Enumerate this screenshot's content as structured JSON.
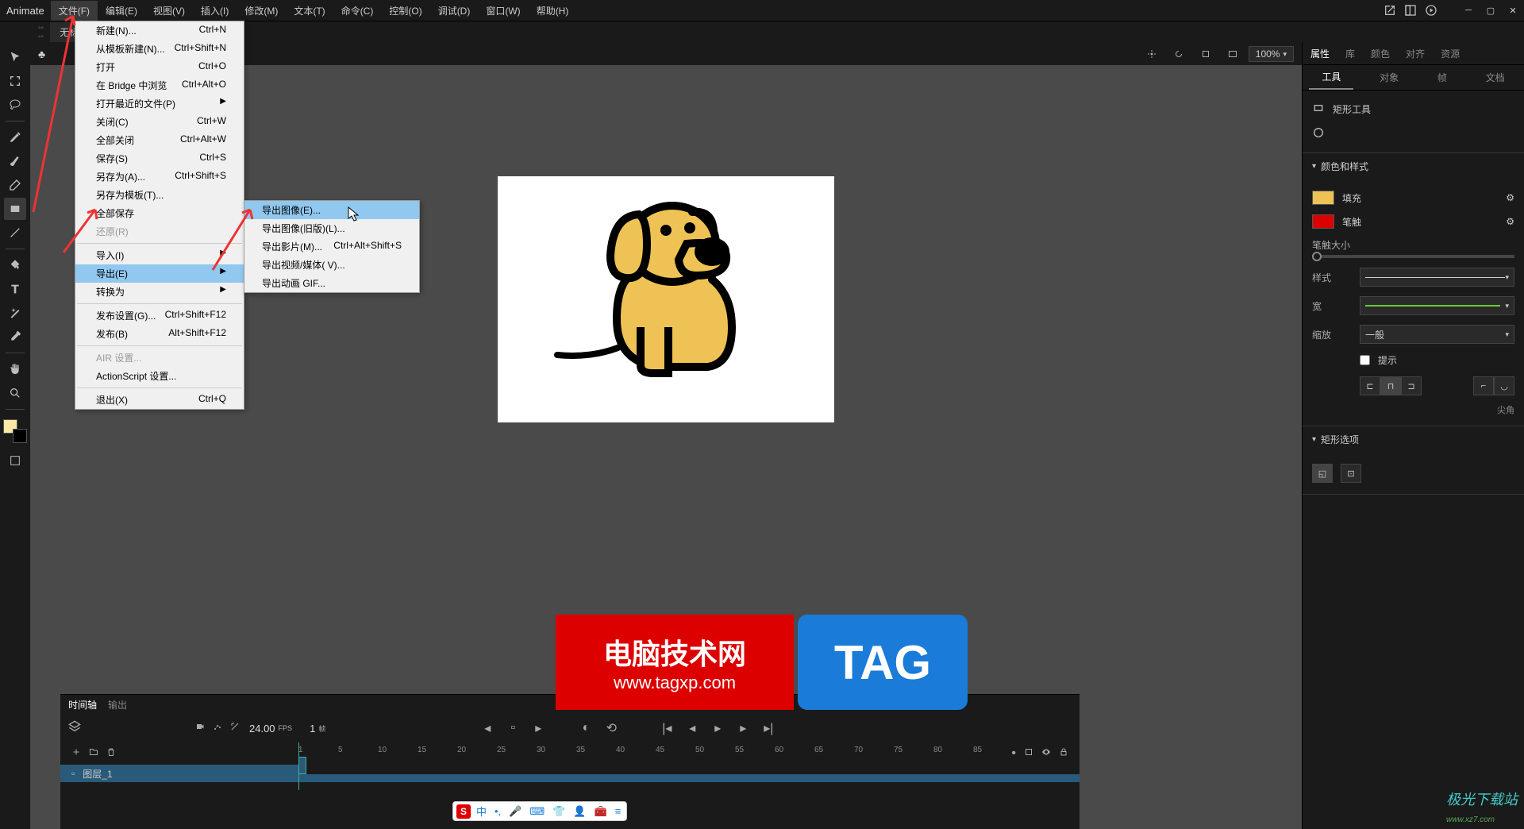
{
  "app": {
    "name": "Animate"
  },
  "menubar": {
    "items": [
      "文件(F)",
      "编辑(E)",
      "视图(V)",
      "插入(I)",
      "修改(M)",
      "文本(T)",
      "命令(C)",
      "控制(O)",
      "调试(D)",
      "窗口(W)",
      "帮助(H)"
    ]
  },
  "document_tab": "无标题-1*",
  "file_menu": {
    "items": [
      {
        "label": "新建(N)...",
        "shortcut": "Ctrl+N"
      },
      {
        "label": "从模板新建(N)...",
        "shortcut": "Ctrl+Shift+N"
      },
      {
        "label": "打开",
        "shortcut": "Ctrl+O"
      },
      {
        "label": "在 Bridge 中浏览",
        "shortcut": "Ctrl+Alt+O"
      },
      {
        "label": "打开最近的文件(P)",
        "shortcut": "",
        "arrow": true
      },
      {
        "label": "关闭(C)",
        "shortcut": "Ctrl+W"
      },
      {
        "label": "全部关闭",
        "shortcut": "Ctrl+Alt+W"
      },
      {
        "label": "保存(S)",
        "shortcut": "Ctrl+S"
      },
      {
        "label": "另存为(A)...",
        "shortcut": "Ctrl+Shift+S"
      },
      {
        "label": "另存为模板(T)...",
        "shortcut": ""
      },
      {
        "label": "全部保存",
        "shortcut": ""
      },
      {
        "label": "还原(R)",
        "shortcut": "",
        "disabled": true
      },
      {
        "sep": true
      },
      {
        "label": "导入(I)",
        "shortcut": "",
        "arrow": true
      },
      {
        "label": "导出(E)",
        "shortcut": "",
        "arrow": true,
        "highlight": true
      },
      {
        "label": "转换为",
        "shortcut": "",
        "arrow": true
      },
      {
        "sep": true
      },
      {
        "label": "发布设置(G)...",
        "shortcut": "Ctrl+Shift+F12"
      },
      {
        "label": "发布(B)",
        "shortcut": "Alt+Shift+F12"
      },
      {
        "sep": true
      },
      {
        "label": "AIR 设置...",
        "shortcut": "",
        "disabled": true
      },
      {
        "label": "ActionScript 设置...",
        "shortcut": ""
      },
      {
        "sep": true
      },
      {
        "label": "退出(X)",
        "shortcut": "Ctrl+Q"
      }
    ]
  },
  "export_submenu": {
    "items": [
      {
        "label": "导出图像(E)...",
        "shortcut": "",
        "highlight": true
      },
      {
        "label": "导出图像(旧版)(L)...",
        "shortcut": ""
      },
      {
        "label": "导出影片(M)...",
        "shortcut": "Ctrl+Alt+Shift+S"
      },
      {
        "label": "导出视频/媒体( V)...",
        "shortcut": ""
      },
      {
        "label": "导出动画 GIF...",
        "shortcut": ""
      }
    ]
  },
  "canvas": {
    "zoom": "100%"
  },
  "properties": {
    "panel_tabs": [
      "属性",
      "库",
      "颜色",
      "对齐",
      "资源"
    ],
    "subtabs": [
      "工具",
      "对象",
      "帧",
      "文档"
    ],
    "tool_name": "矩形工具",
    "section_color": "颜色和样式",
    "fill": "填充",
    "stroke": "笔触",
    "stroke_size": "笔触大小",
    "style": "样式",
    "width": "宽",
    "scale": "缩放",
    "scale_value": "一般",
    "hint": "提示",
    "corner": "尖角",
    "section_rect": "矩形选项"
  },
  "timeline": {
    "tab1": "时间轴",
    "tab2": "输出",
    "fps": "24.00",
    "fps_label": "FPS",
    "frame_num": "1",
    "frame_label": "帧",
    "layer_name": "图层_1",
    "ruler": [
      "1",
      "5",
      "10",
      "15",
      "20",
      "25",
      "30",
      "35",
      "40",
      "45",
      "50",
      "55",
      "60",
      "65",
      "70",
      "75",
      "80",
      "85"
    ]
  },
  "banner": {
    "title": "电脑技术网",
    "url": "www.tagxp.com",
    "tag": "TAG"
  },
  "ime": {
    "lang": "中"
  },
  "watermark": {
    "name": "极光下载站",
    "url": "www.xz7.com"
  }
}
